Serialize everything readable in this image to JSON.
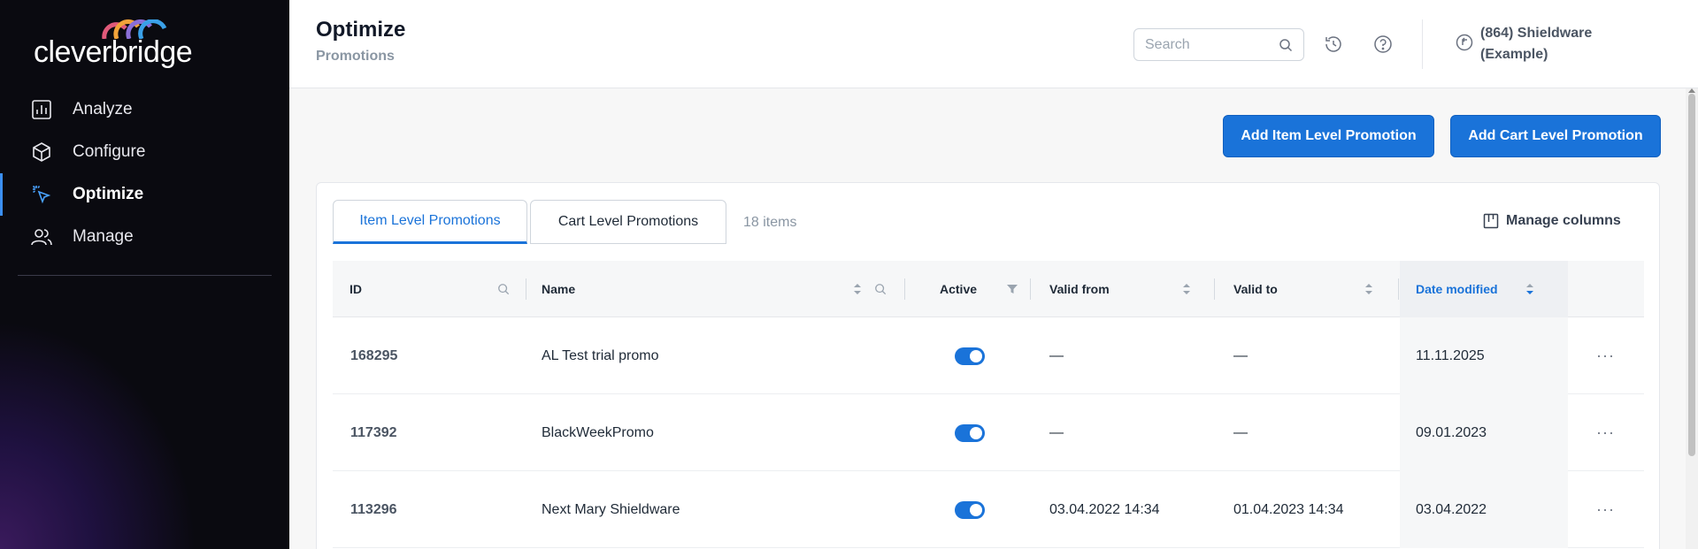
{
  "brand": {
    "logo_text": "cleverbridge"
  },
  "sidebar": {
    "items": [
      {
        "label": "Analyze",
        "icon": "chart-icon"
      },
      {
        "label": "Configure",
        "icon": "cube-icon"
      },
      {
        "label": "Optimize",
        "icon": "cursor-click-icon",
        "active": true
      },
      {
        "label": "Manage",
        "icon": "users-icon"
      }
    ]
  },
  "header": {
    "title": "Optimize",
    "subtitle": "Promotions",
    "search_placeholder": "Search",
    "account": "(864) Shieldware (Example)"
  },
  "actions": {
    "add_item": "Add Item Level Promotion",
    "add_cart": "Add Cart Level Promotion"
  },
  "tabs": {
    "item": "Item Level Promotions",
    "cart": "Cart Level Promotions",
    "count": "18 items",
    "manage_columns": "Manage columns"
  },
  "table": {
    "columns": {
      "id": "ID",
      "name": "Name",
      "active": "Active",
      "valid_from": "Valid from",
      "valid_to": "Valid to",
      "date_modified": "Date modified"
    },
    "rows": [
      {
        "id": "168295",
        "name": "AL Test trial promo",
        "active": true,
        "valid_from": "—",
        "valid_to": "—",
        "date_modified": "11.11.2025"
      },
      {
        "id": "117392",
        "name": "BlackWeekPromo",
        "active": true,
        "valid_from": "—",
        "valid_to": "—",
        "date_modified": "09.01.2023"
      },
      {
        "id": "113296",
        "name": "Next Mary Shieldware",
        "active": true,
        "valid_from": "03.04.2022 14:34",
        "valid_to": "01.04.2023 14:34",
        "date_modified": "03.04.2022"
      }
    ]
  },
  "colors": {
    "accent": "#1a73d9",
    "sidebar_bg": "#0a0a10"
  }
}
